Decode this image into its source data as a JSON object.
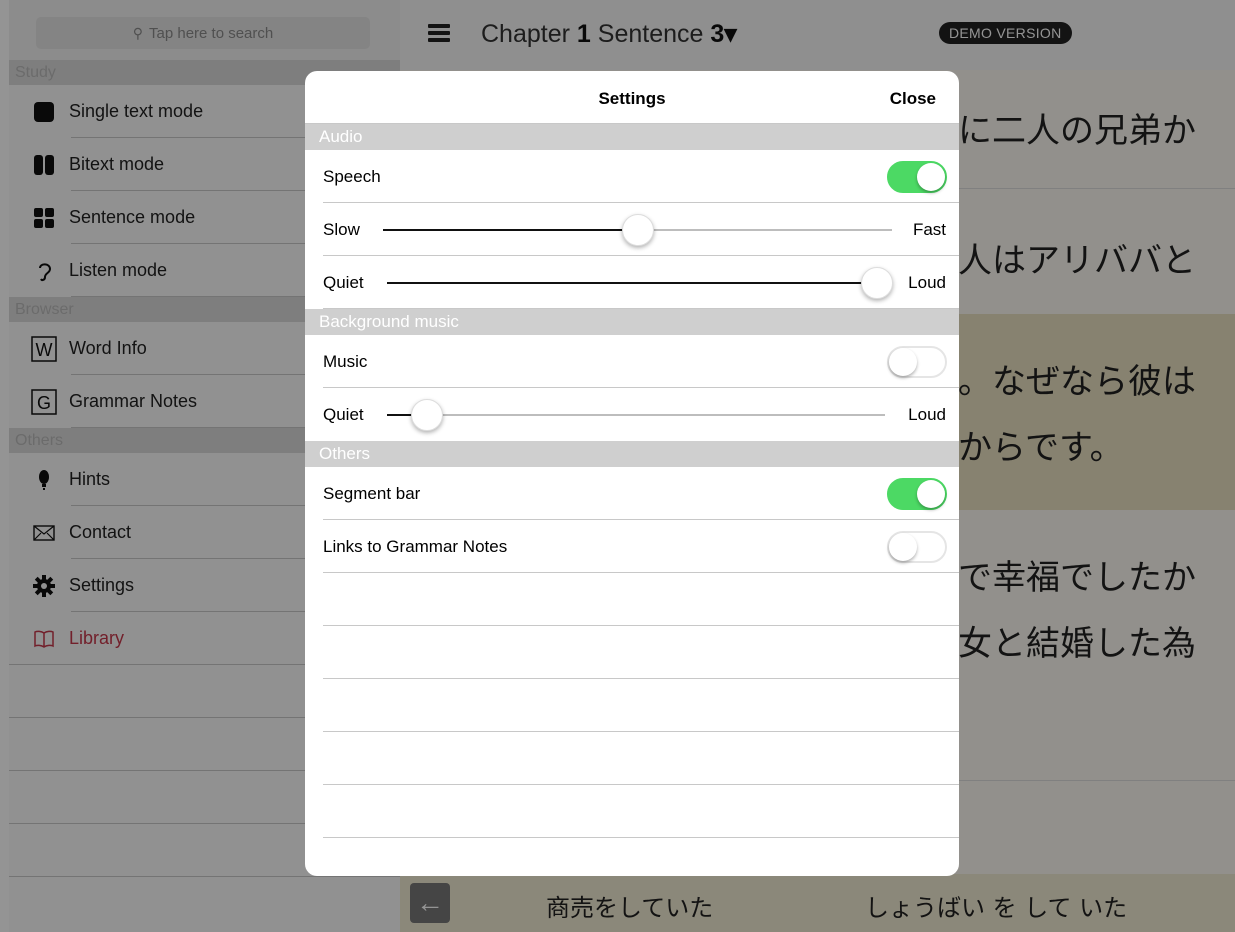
{
  "sidebar": {
    "search_placeholder": "Tap here to search",
    "sections": {
      "study": "Study",
      "browser": "Browser",
      "others": "Others"
    },
    "study_items": [
      {
        "label": "Single text mode",
        "icon": "square-icon"
      },
      {
        "label": "Bitext mode",
        "icon": "two-columns-icon"
      },
      {
        "label": "Sentence mode",
        "icon": "grid-icon"
      },
      {
        "label": "Listen mode",
        "icon": "ear-icon"
      }
    ],
    "browser_items": [
      {
        "label": "Word Info",
        "icon": "w-box-icon",
        "glyph": "W"
      },
      {
        "label": "Grammar Notes",
        "icon": "g-box-icon",
        "glyph": "G"
      }
    ],
    "other_items": [
      {
        "label": "Hints",
        "icon": "lightbulb-icon"
      },
      {
        "label": "Contact",
        "icon": "envelope-icon"
      },
      {
        "label": "Settings",
        "icon": "gear-icon"
      },
      {
        "label": "Library",
        "icon": "book-icon",
        "color": "#c5374a"
      }
    ]
  },
  "header": {
    "chapter_label": "Chapter",
    "chapter_number": "1",
    "sentence_label": "Sentence",
    "sentence_number": "3",
    "dropdown_glyph": "▾",
    "demo_badge": "DEMO VERSION"
  },
  "reader": {
    "lines": [
      "に二人の兄弟か",
      "人はアリババと",
      "。なぜなら彼は",
      "からです。",
      "で幸福でしたか",
      "女と結婚した為"
    ]
  },
  "bottom_bar": {
    "word": "商売をしていた",
    "reading": "しょうばい を して いた"
  },
  "settings": {
    "title": "Settings",
    "close_label": "Close",
    "sections": {
      "audio": "Audio",
      "background_music": "Background music",
      "others": "Others"
    },
    "speech": {
      "label": "Speech",
      "on": true
    },
    "speed": {
      "left": "Slow",
      "right": "Fast",
      "value": 0.5
    },
    "audio_volume": {
      "left": "Quiet",
      "right": "Loud",
      "value": 1.0
    },
    "music": {
      "label": "Music",
      "on": false
    },
    "music_volume": {
      "left": "Quiet",
      "right": "Loud",
      "value": 0.08
    },
    "segment_bar": {
      "label": "Segment bar",
      "on": true
    },
    "grammar_links": {
      "label": "Links to Grammar Notes",
      "on": false
    }
  },
  "colors": {
    "toggle_on": "#4cd964",
    "library_accent": "#c5374a",
    "reader_background": "#f4f0e2"
  }
}
